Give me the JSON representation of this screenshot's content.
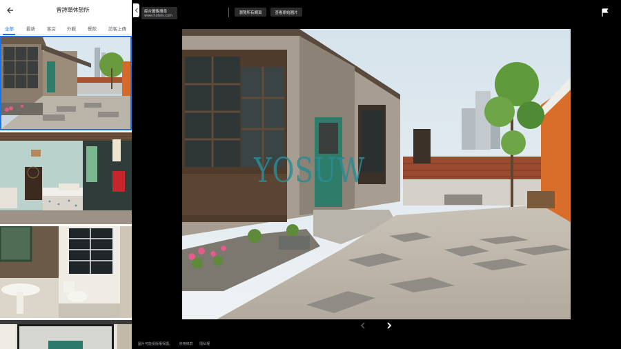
{
  "panel": {
    "title": "曾詩頤休憩所",
    "tabs": [
      "全部",
      "最新",
      "客房",
      "外觀",
      "餐飲",
      "訪客上傳"
    ]
  },
  "source": {
    "name": "綜合圖像搜尋",
    "url": "www.hotels.com"
  },
  "toolbar": {
    "btn1": "瀏覽所有網頁",
    "btn2": "查看原始圖片"
  },
  "watermark": "YOSUW",
  "footer": {
    "disclaimer": "圖片可能受版權保護。",
    "terms": "使用條款",
    "privacy": "隱私權"
  },
  "colors": {
    "accent": "#1a73e8",
    "watermark": "#2a8b95",
    "background": "#000000"
  }
}
